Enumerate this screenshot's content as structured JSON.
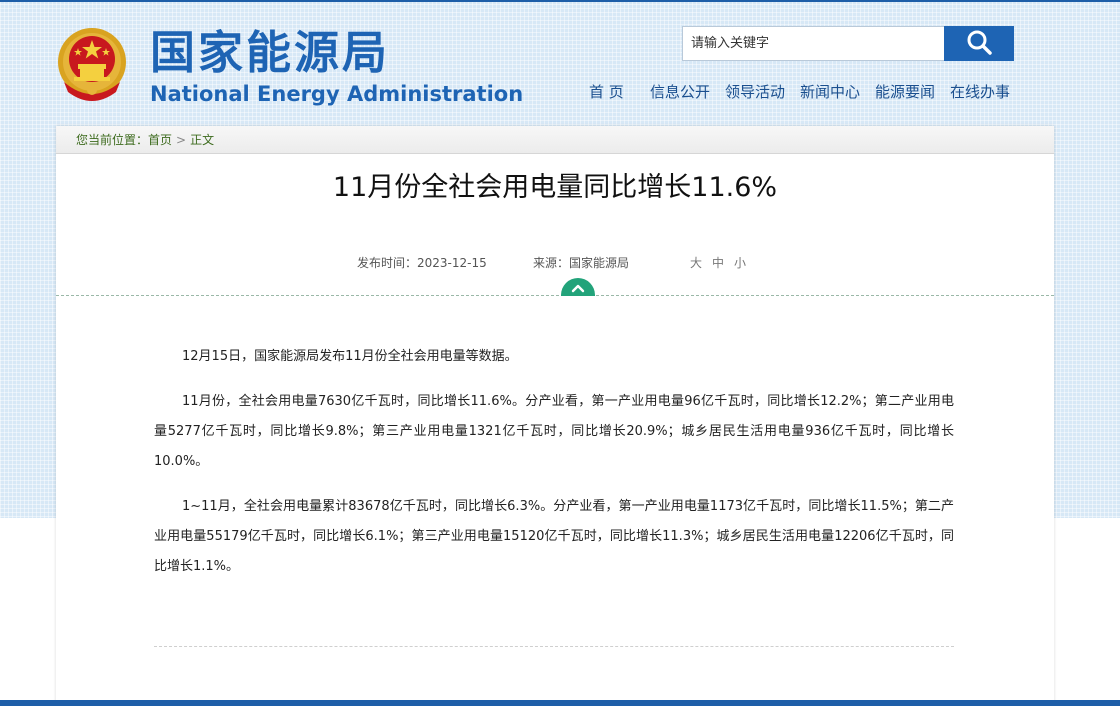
{
  "header": {
    "logo_cn": "国家能源局",
    "logo_en": "National Energy Administration",
    "brand_color": "#1e64b4",
    "emblem_icon": "national-emblem-icon"
  },
  "search": {
    "placeholder": "请输入关键字",
    "button_icon": "search-icon"
  },
  "nav": {
    "items": [
      {
        "label": "首 页"
      },
      {
        "label": "信息公开"
      },
      {
        "label": "领导活动"
      },
      {
        "label": "新闻中心"
      },
      {
        "label": "能源要闻"
      },
      {
        "label": "在线办事"
      }
    ]
  },
  "breadcrumb": {
    "prefix": "您当前位置：",
    "home": "首页",
    "separator": ">",
    "current": "正文"
  },
  "article": {
    "title": "11月份全社会用电量同比增长11.6%",
    "publish_label": "发布时间：2023-12-15",
    "source_label": "来源：国家能源局",
    "font_sizes": [
      "大",
      "中",
      "小"
    ],
    "paragraphs": [
      "12月15日，国家能源局发布11月份全社会用电量等数据。",
      "11月份，全社会用电量7630亿千瓦时，同比增长11.6%。分产业看，第一产业用电量96亿千瓦时，同比增长12.2%；第二产业用电量5277亿千瓦时，同比增长9.8%；第三产业用电量1321亿千瓦时，同比增长20.9%；城乡居民生活用电量936亿千瓦时，同比增长10.0%。",
      "1~11月，全社会用电量累计83678亿千瓦时，同比增长6.3%。分产业看，第一产业用电量1173亿千瓦时，同比增长11.5%；第二产业用电量55179亿千瓦时，同比增长6.1%；第三产业用电量15120亿千瓦时，同比增长11.3%；城乡居民生活用电量12206亿千瓦时，同比增长1.1%。"
    ],
    "toggle_icon": "chevron-up-icon",
    "accent_color": "#22a37a"
  }
}
